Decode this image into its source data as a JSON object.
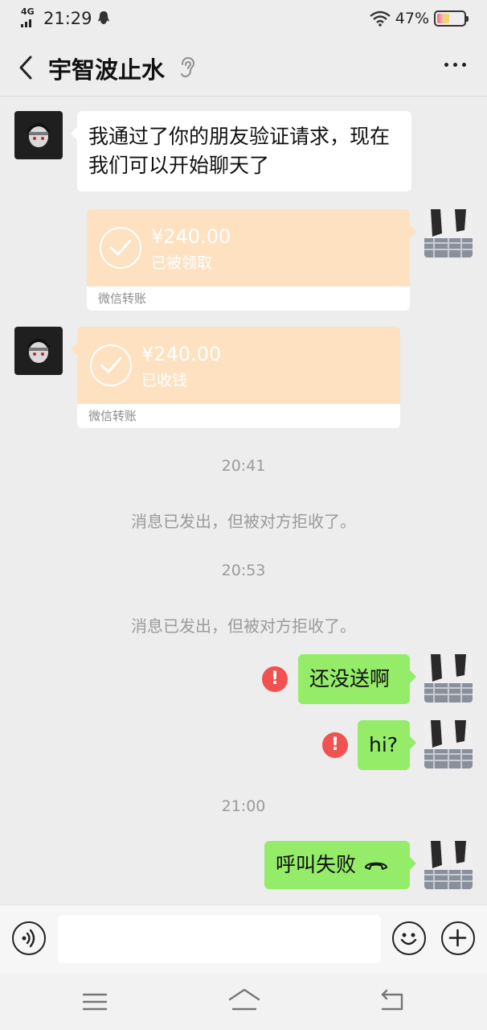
{
  "status_bar": {
    "network": "4G",
    "time": "21:29",
    "battery": "47%",
    "battery_level": 0.47
  },
  "header": {
    "contact_name": "宇智波止水"
  },
  "messages": {
    "m1_text": "我通过了你的朋友验证请求，现在我们可以开始聊天了",
    "transfer1": {
      "amount": "¥240.00",
      "status": "已被领取",
      "footer": "微信转账"
    },
    "transfer2": {
      "amount": "¥240.00",
      "status": "已收钱",
      "footer": "微信转账"
    },
    "time1": "20:41",
    "sys1": "消息已发出，但被对方拒收了。",
    "time2": "20:53",
    "sys2": "消息已发出，但被对方拒收了。",
    "m2_text": "还没送啊",
    "m3_text": "hi?",
    "time3": "21:00",
    "m4_text": "呼叫失败",
    "error_mark": "!"
  },
  "input_bar": {
    "placeholder": ""
  },
  "colors": {
    "chat_background": "#ededed",
    "sent_bubble": "#95ec69",
    "received_bubble": "#ffffff",
    "transfer_card": "#fde1c1",
    "error_badge": "#f05252"
  },
  "icons": {
    "back": "chevron-left-icon",
    "ear": "ear-icon",
    "more": "more-dots-icon",
    "voice": "voice-icon",
    "emoji": "emoji-icon",
    "plus": "plus-icon",
    "check": "check-icon",
    "error": "error-icon",
    "hangup": "phone-hangup-icon"
  }
}
